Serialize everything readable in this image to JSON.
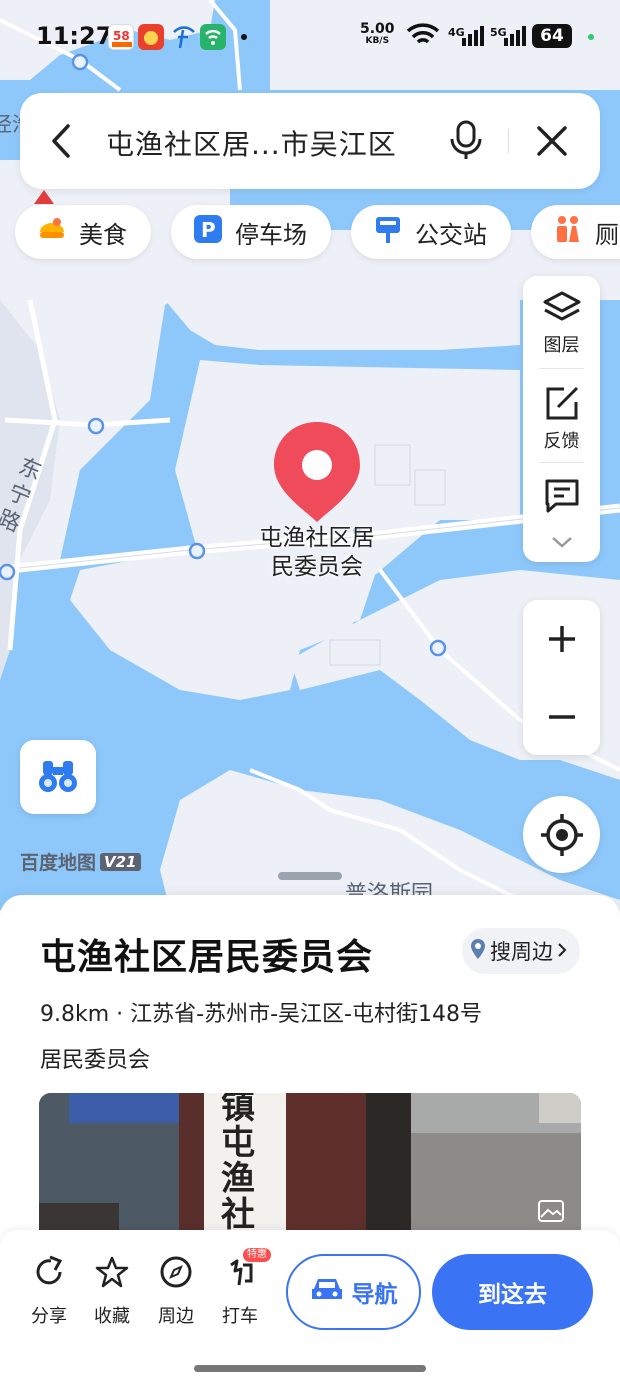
{
  "status_bar": {
    "time": "11:27",
    "net_speed_value": "5.00",
    "net_speed_unit": "KB/S",
    "sim1_tech": "4G",
    "sim2_tech": "5G",
    "battery": "64"
  },
  "search": {
    "query": "屯渔社区居...市吴江区"
  },
  "chips": [
    {
      "label": "美食",
      "icon": "food-icon"
    },
    {
      "label": "停车场",
      "icon": "parking-icon"
    },
    {
      "label": "公交站",
      "icon": "bus-stop-icon"
    },
    {
      "label": "厕",
      "icon": "toilet-icon"
    }
  ],
  "tools": {
    "layers": "图层",
    "feedback": "反馈"
  },
  "map": {
    "poi_label_line1": "屯渔社区居",
    "poi_label_line2": "民委员会",
    "road_label": "东宁路",
    "bottom_label": "普洛斯园",
    "corner_label": "泾浩",
    "logo_text": "百度地图",
    "logo_version": "V21"
  },
  "poi": {
    "title": "屯渔社区居民委员会",
    "nearby_button": "搜周边",
    "distance": "9.8km",
    "address": "江苏省-苏州市-吴江区-屯村街148号",
    "category": "居民委员会",
    "photo_sign_text": "镇屯渔社区居民"
  },
  "actions": {
    "share": "分享",
    "favorite": "收藏",
    "nearby": "周边",
    "taxi": "打车",
    "taxi_badge": "特惠",
    "navigate": "导航",
    "go_here": "到这去"
  },
  "colors": {
    "accent": "#3a74f5",
    "marker": "#ef4b5a",
    "water": "#8ec8fb",
    "land": "#edf0f7"
  }
}
